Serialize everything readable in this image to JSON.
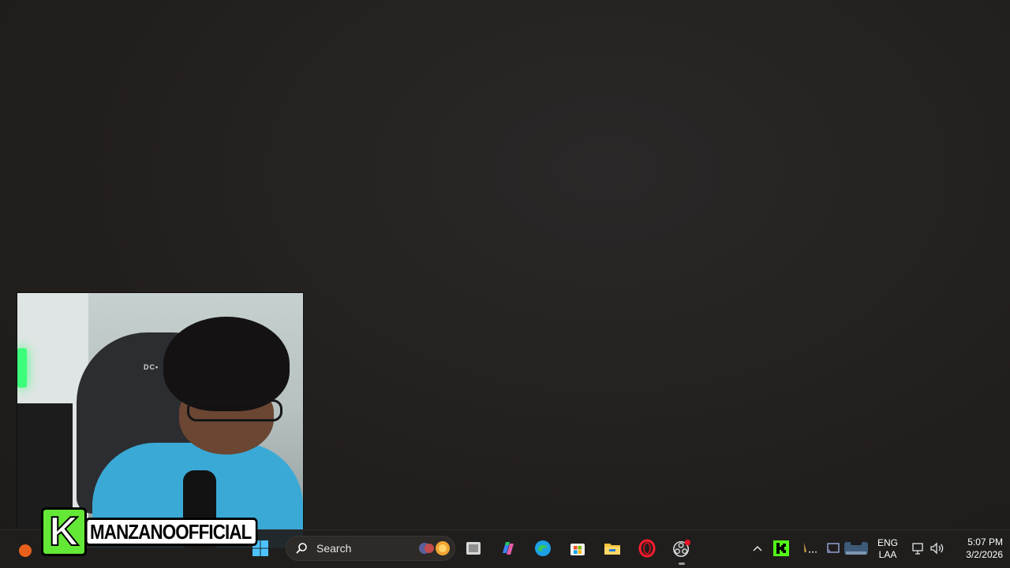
{
  "badge": {
    "name": "MANZANOOFFICIAL",
    "logo_letter": "K"
  },
  "webcam": {
    "chair_brand": "DC•"
  },
  "taskbar": {
    "search_label": "Search",
    "pinned_apps": [
      "task-view-icon",
      "copilot-icon",
      "edge-icon",
      "store-icon",
      "file-explorer-icon",
      "opera-icon",
      "obs-icon"
    ],
    "tray": {
      "language_top": "ENG",
      "language_bottom": "LAA",
      "time": "5:07 PM",
      "date": "3/2/2026",
      "chevron": "^"
    }
  },
  "colors": {
    "desktop": "#231f1d",
    "taskbar": "#201e1d",
    "badge_green": "#64e836",
    "shirt": "#3aa9d6"
  }
}
